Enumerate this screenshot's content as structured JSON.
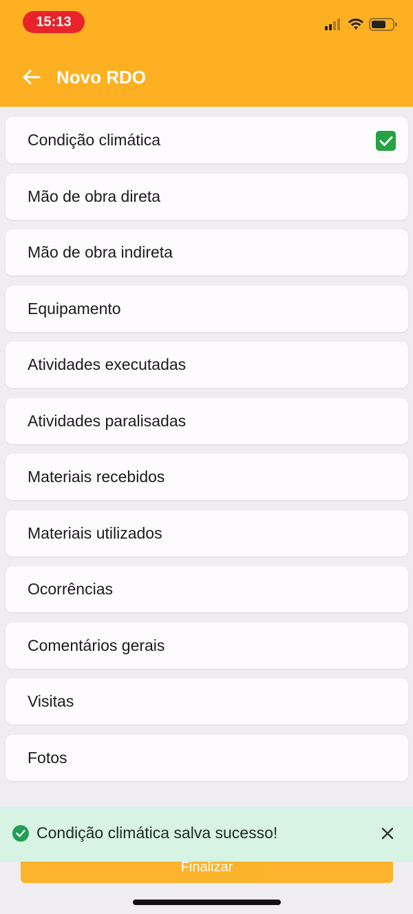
{
  "status_bar": {
    "time": "15:13",
    "icons": [
      "signal-icon",
      "wifi-icon",
      "battery-icon"
    ]
  },
  "header": {
    "title": "Novo RDO",
    "back_icon": "arrow-left-icon",
    "background_color": "#fdb022"
  },
  "sections": [
    {
      "label": "Condição climática",
      "completed": true
    },
    {
      "label": "Mão de obra direta",
      "completed": false
    },
    {
      "label": "Mão de obra indireta",
      "completed": false
    },
    {
      "label": "Equipamento",
      "completed": false
    },
    {
      "label": "Atividades executadas",
      "completed": false
    },
    {
      "label": "Atividades paralisadas",
      "completed": false
    },
    {
      "label": "Materiais recebidos",
      "completed": false
    },
    {
      "label": "Materiais utilizados",
      "completed": false
    },
    {
      "label": "Ocorrências",
      "completed": false
    },
    {
      "label": "Comentários gerais",
      "completed": false
    },
    {
      "label": "Visitas",
      "completed": false
    },
    {
      "label": "Fotos",
      "completed": false
    }
  ],
  "footer": {
    "finalize_label": "Finalizar"
  },
  "toast": {
    "message": "Condição climática salva sucesso!",
    "status_color": "#1f9e55",
    "background_color": "#d6f3e3",
    "icon": "check-circle-icon",
    "close_icon": "close-icon"
  }
}
